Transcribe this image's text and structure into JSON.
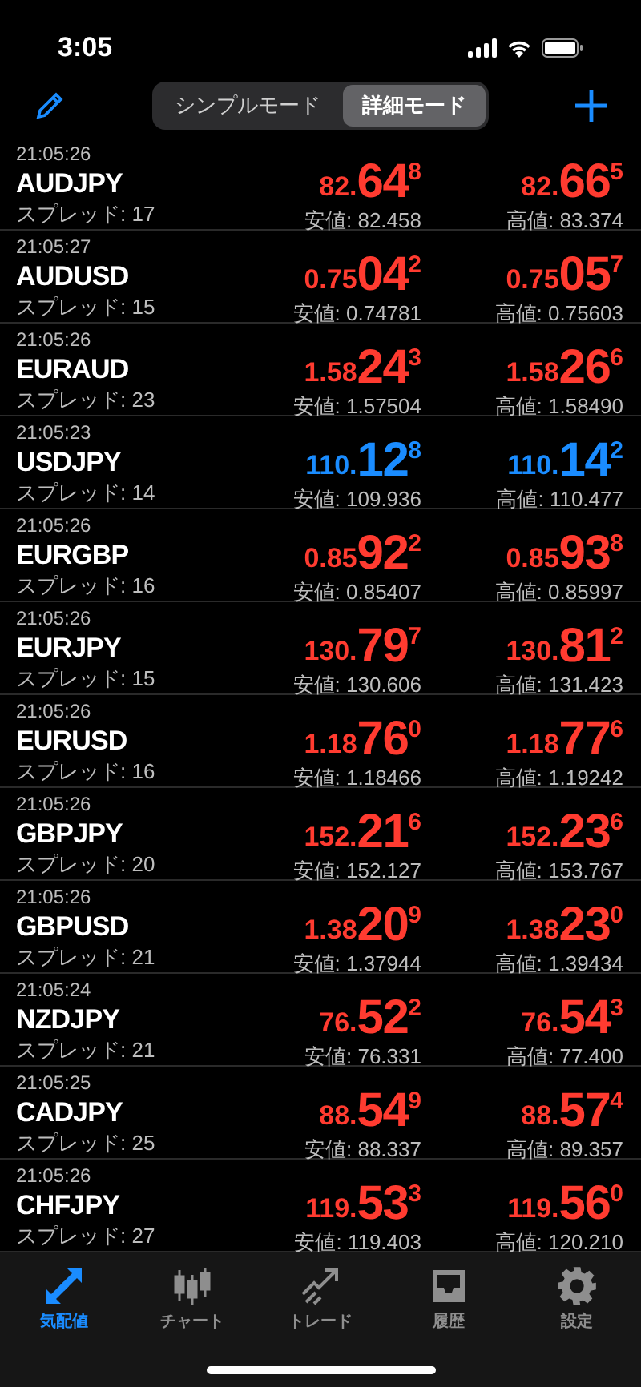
{
  "status_bar": {
    "time": "3:05"
  },
  "mode_switch": [
    {
      "label": "シンプルモード",
      "selected": false
    },
    {
      "label": "詳細モード",
      "selected": true
    }
  ],
  "quotes": [
    {
      "time": "21:05:26",
      "symbol": "AUDJPY",
      "spread": "スプレッド: 17",
      "color": "#ff3b30",
      "bid": {
        "prefix": "82.",
        "big": "64",
        "pip": "8"
      },
      "low": "安値: 82.458",
      "ask": {
        "prefix": "82.",
        "big": "66",
        "pip": "5"
      },
      "high": "高値: 83.374"
    },
    {
      "time": "21:05:27",
      "symbol": "AUDUSD",
      "spread": "スプレッド: 15",
      "color": "#ff3b30",
      "bid": {
        "prefix": "0.75",
        "big": "04",
        "pip": "2"
      },
      "low": "安値: 0.74781",
      "ask": {
        "prefix": "0.75",
        "big": "05",
        "pip": "7"
      },
      "high": "高値: 0.75603"
    },
    {
      "time": "21:05:26",
      "symbol": "EURAUD",
      "spread": "スプレッド: 23",
      "color": "#ff3b30",
      "bid": {
        "prefix": "1.58",
        "big": "24",
        "pip": "3"
      },
      "low": "安値: 1.57504",
      "ask": {
        "prefix": "1.58",
        "big": "26",
        "pip": "6"
      },
      "high": "高値: 1.58490"
    },
    {
      "time": "21:05:23",
      "symbol": "USDJPY",
      "spread": "スプレッド: 14",
      "color": "#1a8cff",
      "bid": {
        "prefix": "110.",
        "big": "12",
        "pip": "8"
      },
      "low": "安値: 109.936",
      "ask": {
        "prefix": "110.",
        "big": "14",
        "pip": "2"
      },
      "high": "高値: 110.477"
    },
    {
      "time": "21:05:26",
      "symbol": "EURGBP",
      "spread": "スプレッド: 16",
      "color": "#ff3b30",
      "bid": {
        "prefix": "0.85",
        "big": "92",
        "pip": "2"
      },
      "low": "安値: 0.85407",
      "ask": {
        "prefix": "0.85",
        "big": "93",
        "pip": "8"
      },
      "high": "高値: 0.85997"
    },
    {
      "time": "21:05:26",
      "symbol": "EURJPY",
      "spread": "スプレッド: 15",
      "color": "#ff3b30",
      "bid": {
        "prefix": "130.",
        "big": "79",
        "pip": "7"
      },
      "low": "安値: 130.606",
      "ask": {
        "prefix": "130.",
        "big": "81",
        "pip": "2"
      },
      "high": "高値: 131.423"
    },
    {
      "time": "21:05:26",
      "symbol": "EURUSD",
      "spread": "スプレッド: 16",
      "color": "#ff3b30",
      "bid": {
        "prefix": "1.18",
        "big": "76",
        "pip": "0"
      },
      "low": "安値: 1.18466",
      "ask": {
        "prefix": "1.18",
        "big": "77",
        "pip": "6"
      },
      "high": "高値: 1.19242"
    },
    {
      "time": "21:05:26",
      "symbol": "GBPJPY",
      "spread": "スプレッド: 20",
      "color": "#ff3b30",
      "bid": {
        "prefix": "152.",
        "big": "21",
        "pip": "6"
      },
      "low": "安値: 152.127",
      "ask": {
        "prefix": "152.",
        "big": "23",
        "pip": "6"
      },
      "high": "高値: 153.767"
    },
    {
      "time": "21:05:26",
      "symbol": "GBPUSD",
      "spread": "スプレッド: 21",
      "color": "#ff3b30",
      "bid": {
        "prefix": "1.38",
        "big": "20",
        "pip": "9"
      },
      "low": "安値: 1.37944",
      "ask": {
        "prefix": "1.38",
        "big": "23",
        "pip": "0"
      },
      "high": "高値: 1.39434"
    },
    {
      "time": "21:05:24",
      "symbol": "NZDJPY",
      "spread": "スプレッド: 21",
      "color": "#ff3b30",
      "bid": {
        "prefix": "76.",
        "big": "52",
        "pip": "2"
      },
      "low": "安値: 76.331",
      "ask": {
        "prefix": "76.",
        "big": "54",
        "pip": "3"
      },
      "high": "高値: 77.400"
    },
    {
      "time": "21:05:25",
      "symbol": "CADJPY",
      "spread": "スプレッド: 25",
      "color": "#ff3b30",
      "bid": {
        "prefix": "88.",
        "big": "54",
        "pip": "9"
      },
      "low": "安値: 88.337",
      "ask": {
        "prefix": "88.",
        "big": "57",
        "pip": "4"
      },
      "high": "高値: 89.357"
    },
    {
      "time": "21:05:26",
      "symbol": "CHFJPY",
      "spread": "スプレッド: 27",
      "color": "#ff3b30",
      "bid": {
        "prefix": "119.",
        "big": "53",
        "pip": "3"
      },
      "low": "安値: 119.403",
      "ask": {
        "prefix": "119.",
        "big": "56",
        "pip": "0"
      },
      "high": "高値: 120.210"
    }
  ],
  "tab_bar": [
    {
      "label": "気配値",
      "kind": "quotes",
      "selected": true
    },
    {
      "label": "チャート",
      "kind": "chart",
      "selected": false
    },
    {
      "label": "トレード",
      "kind": "trade",
      "selected": false
    },
    {
      "label": "履歴",
      "kind": "history",
      "selected": false
    },
    {
      "label": "設定",
      "kind": "settings",
      "selected": false
    }
  ]
}
